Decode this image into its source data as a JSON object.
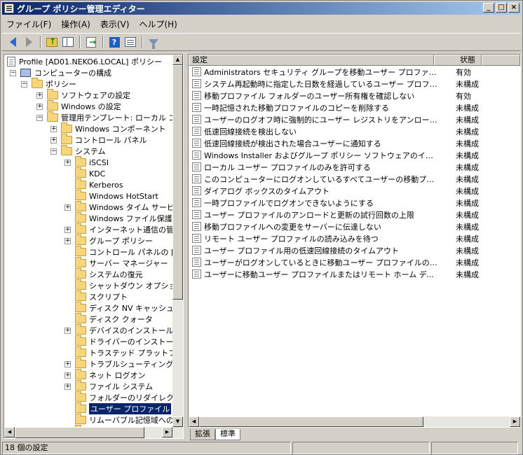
{
  "window": {
    "title": "グループ ポリシー管理エディター",
    "controls": [
      "_",
      "□",
      "×"
    ]
  },
  "menu": [
    "ファイル(F)",
    "操作(A)",
    "表示(V)",
    "ヘルプ(H)"
  ],
  "toolbar": {
    "icons": [
      "back-arrow-icon",
      "forward-arrow-icon",
      "up-folder-icon",
      "show-pane-icon",
      "export-list-icon",
      "help-icon",
      "properties-icon",
      "filter-icon"
    ]
  },
  "tree": [
    {
      "label": "Profile [AD01.NEKO6.LOCAL] ポリシー",
      "indent": 0,
      "expander": "",
      "icon": "doc-icon"
    },
    {
      "label": "コンピューターの構成",
      "indent": 1,
      "expander": "−",
      "icon": "pc-icon"
    },
    {
      "label": "ポリシー",
      "indent": 2,
      "expander": "−",
      "icon": "folder-icon"
    },
    {
      "label": "ソフトウェアの設定",
      "indent": 3,
      "expander": "+",
      "icon": "folder-icon"
    },
    {
      "label": "Windows の設定",
      "indent": 3,
      "expander": "+",
      "icon": "folder-icon"
    },
    {
      "label": "管理用テンプレート: ローカル コン",
      "indent": 3,
      "expander": "−",
      "icon": "folder-icon"
    },
    {
      "label": "Windows コンポーネント",
      "indent": 4,
      "expander": "+",
      "icon": "folder-icon"
    },
    {
      "label": "コントロール パネル",
      "indent": 4,
      "expander": "+",
      "icon": "folder-icon"
    },
    {
      "label": "システム",
      "indent": 4,
      "expander": "−",
      "icon": "folder-icon"
    },
    {
      "label": "iSCSI",
      "indent": 5,
      "expander": "+",
      "icon": "folder-icon"
    },
    {
      "label": "KDC",
      "indent": 5,
      "expander": "",
      "icon": "folder-icon"
    },
    {
      "label": "Kerberos",
      "indent": 5,
      "expander": "",
      "icon": "folder-icon"
    },
    {
      "label": "Windows HotStart",
      "indent": 5,
      "expander": "",
      "icon": "folder-icon"
    },
    {
      "label": "Windows タイム サービス",
      "indent": 5,
      "expander": "+",
      "icon": "folder-icon"
    },
    {
      "label": "Windows ファイル保護",
      "indent": 5,
      "expander": "",
      "icon": "folder-icon"
    },
    {
      "label": "インターネット通信の管理",
      "indent": 5,
      "expander": "+",
      "icon": "folder-icon"
    },
    {
      "label": "グループ ポリシー",
      "indent": 5,
      "expander": "+",
      "icon": "folder-icon"
    },
    {
      "label": "コントロール パネルの [パフ",
      "indent": 5,
      "expander": "",
      "icon": "folder-icon"
    },
    {
      "label": "サーバー マネージャー",
      "indent": 5,
      "expander": "",
      "icon": "folder-icon"
    },
    {
      "label": "システムの復元",
      "indent": 5,
      "expander": "",
      "icon": "folder-icon"
    },
    {
      "label": "シャットダウン オプション",
      "indent": 5,
      "expander": "",
      "icon": "folder-icon"
    },
    {
      "label": "スクリプト",
      "indent": 5,
      "expander": "",
      "icon": "folder-icon"
    },
    {
      "label": "ディスク NV キャッシュ",
      "indent": 5,
      "expander": "",
      "icon": "folder-icon"
    },
    {
      "label": "ディスク クォータ",
      "indent": 5,
      "expander": "",
      "icon": "folder-icon"
    },
    {
      "label": "デバイスのインストール",
      "indent": 5,
      "expander": "+",
      "icon": "folder-icon"
    },
    {
      "label": "ドライバーのインストール",
      "indent": 5,
      "expander": "",
      "icon": "folder-icon"
    },
    {
      "label": "トラステッド プラットフォーム",
      "indent": 5,
      "expander": "",
      "icon": "folder-icon"
    },
    {
      "label": "トラブルシューティングと診断",
      "indent": 5,
      "expander": "+",
      "icon": "folder-icon"
    },
    {
      "label": "ネット ログオン",
      "indent": 5,
      "expander": "+",
      "icon": "folder-icon"
    },
    {
      "label": "ファイル システム",
      "indent": 5,
      "expander": "+",
      "icon": "folder-icon"
    },
    {
      "label": "フォルダーのリダイレクト",
      "indent": 5,
      "expander": "",
      "icon": "folder-icon"
    },
    {
      "label": "ユーザー プロファイル",
      "indent": 5,
      "expander": "",
      "icon": "folder-icon",
      "selected": true
    },
    {
      "label": "リムーバブル記憶域へのア",
      "indent": 5,
      "expander": "",
      "icon": "folder-icon"
    },
    {
      "label": "リモート アシスタンス",
      "indent": 5,
      "expander": "",
      "icon": "folder-icon"
    }
  ],
  "list": {
    "columns": [
      "設定",
      "状態"
    ],
    "rows": [
      {
        "name": "Administrators セキュリティ グループを移動ユーザー プロファイルに...",
        "state": "有効"
      },
      {
        "name": "システム再起動時に指定した日数を経過しているユーザー プロファイ...",
        "state": "未構成"
      },
      {
        "name": "移動プロファイル フォルダーのユーザー所有権を確認しない",
        "state": "有効"
      },
      {
        "name": "一時記憶された移動プロファイルのコピーを削除する",
        "state": "未構成"
      },
      {
        "name": "ユーザーのログオフ時に強制的にユーザー レジストリをアンロードしない",
        "state": "未構成"
      },
      {
        "name": "低速回線接続を検出しない",
        "state": "未構成"
      },
      {
        "name": "低速回線接続が検出された場合ユーザーに通知する",
        "state": "未構成"
      },
      {
        "name": "Windows Installer およびグループ ポリシー ソフトウェアのインストール...",
        "state": "未構成"
      },
      {
        "name": "ローカル ユーザー プロファイルのみを許可する",
        "state": "未構成"
      },
      {
        "name": "このコンピューターにログオンしているすべてユーザーの移動プロファイル...",
        "state": "未構成"
      },
      {
        "name": "ダイアログ ボックスのタイムアウト",
        "state": "未構成"
      },
      {
        "name": "一時プロファイルでログオンできないようにする",
        "state": "未構成"
      },
      {
        "name": "ユーザー プロファイルのアンロードと更新の試行回数の上限",
        "state": "未構成"
      },
      {
        "name": "移動プロファイルへの変更をサーバーに伝達しない",
        "state": "未構成"
      },
      {
        "name": "リモート ユーザー プロファイルの読み込みを待つ",
        "state": "未構成"
      },
      {
        "name": "ユーザー プロファイル用の低速回線接続のタイムアウト",
        "state": "未構成"
      },
      {
        "name": "ユーザーがログオンしているときに移動ユーザー プロファイルのレジスト...",
        "state": "未構成"
      },
      {
        "name": "ユーザーに移動ユーザー プロファイルまたはリモート ホーム ディレクトリ...",
        "state": "未構成"
      }
    ]
  },
  "tabs": [
    "拡張",
    "標準"
  ],
  "active_tab": "標準",
  "status": {
    "text": "18 個の設定"
  }
}
